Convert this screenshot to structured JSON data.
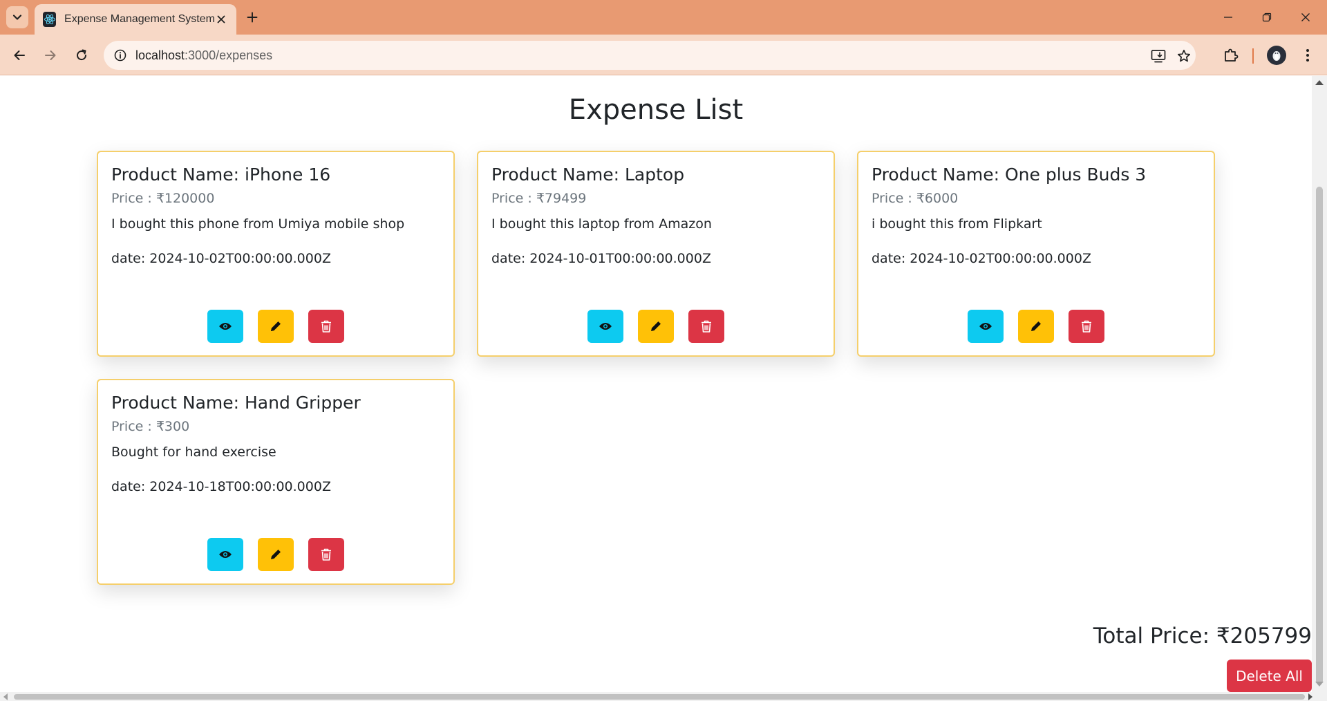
{
  "browser": {
    "tab_title": "Expense Management System",
    "url_host": "localhost",
    "url_path": ":3000/expenses",
    "icons": {
      "tab_search": "chevron-down-icon",
      "favicon": "react-logo-icon",
      "tab_close": "close-icon",
      "new_tab": "plus-icon",
      "back": "arrow-left-icon",
      "forward": "arrow-right-icon",
      "reload": "reload-icon",
      "site_info": "info-icon",
      "install": "install-app-icon",
      "bookmark": "star-icon",
      "extensions": "puzzle-icon",
      "profile": "avatar-icon",
      "menu": "more-vertical-icon"
    }
  },
  "page": {
    "title": "Expense List",
    "total_price": "Total Price: ₹205799",
    "delete_all_label": "Delete All"
  },
  "expenses": [
    {
      "name": "Product Name: iPhone 16",
      "price": "Price : ₹120000",
      "description": "I bought this phone from Umiya mobile shop",
      "date": "date: 2024-10-02T00:00:00.000Z"
    },
    {
      "name": "Product Name: Laptop",
      "price": "Price : ₹79499",
      "description": "I bought this laptop from Amazon",
      "date": "date: 2024-10-01T00:00:00.000Z"
    },
    {
      "name": "Product Name: One plus Buds 3",
      "price": "Price : ₹6000",
      "description": "i bought this from Flipkart",
      "date": "date: 2024-10-02T00:00:00.000Z"
    },
    {
      "name": "Product Name: Hand Gripper",
      "price": "Price : ₹300",
      "description": "Bought for hand exercise",
      "date": "date: 2024-10-18T00:00:00.000Z"
    }
  ],
  "card_actions": {
    "view_icon": "eye-icon",
    "edit_icon": "pencil-icon",
    "delete_icon": "trash-icon"
  },
  "colors": {
    "chrome_titlebar": "#e89a72",
    "chrome_toolbar": "#f7d8c6",
    "card_border": "#f5cf6b",
    "view_button": "#0dcaf0",
    "edit_button": "#ffc107",
    "delete_button": "#dc3545"
  }
}
